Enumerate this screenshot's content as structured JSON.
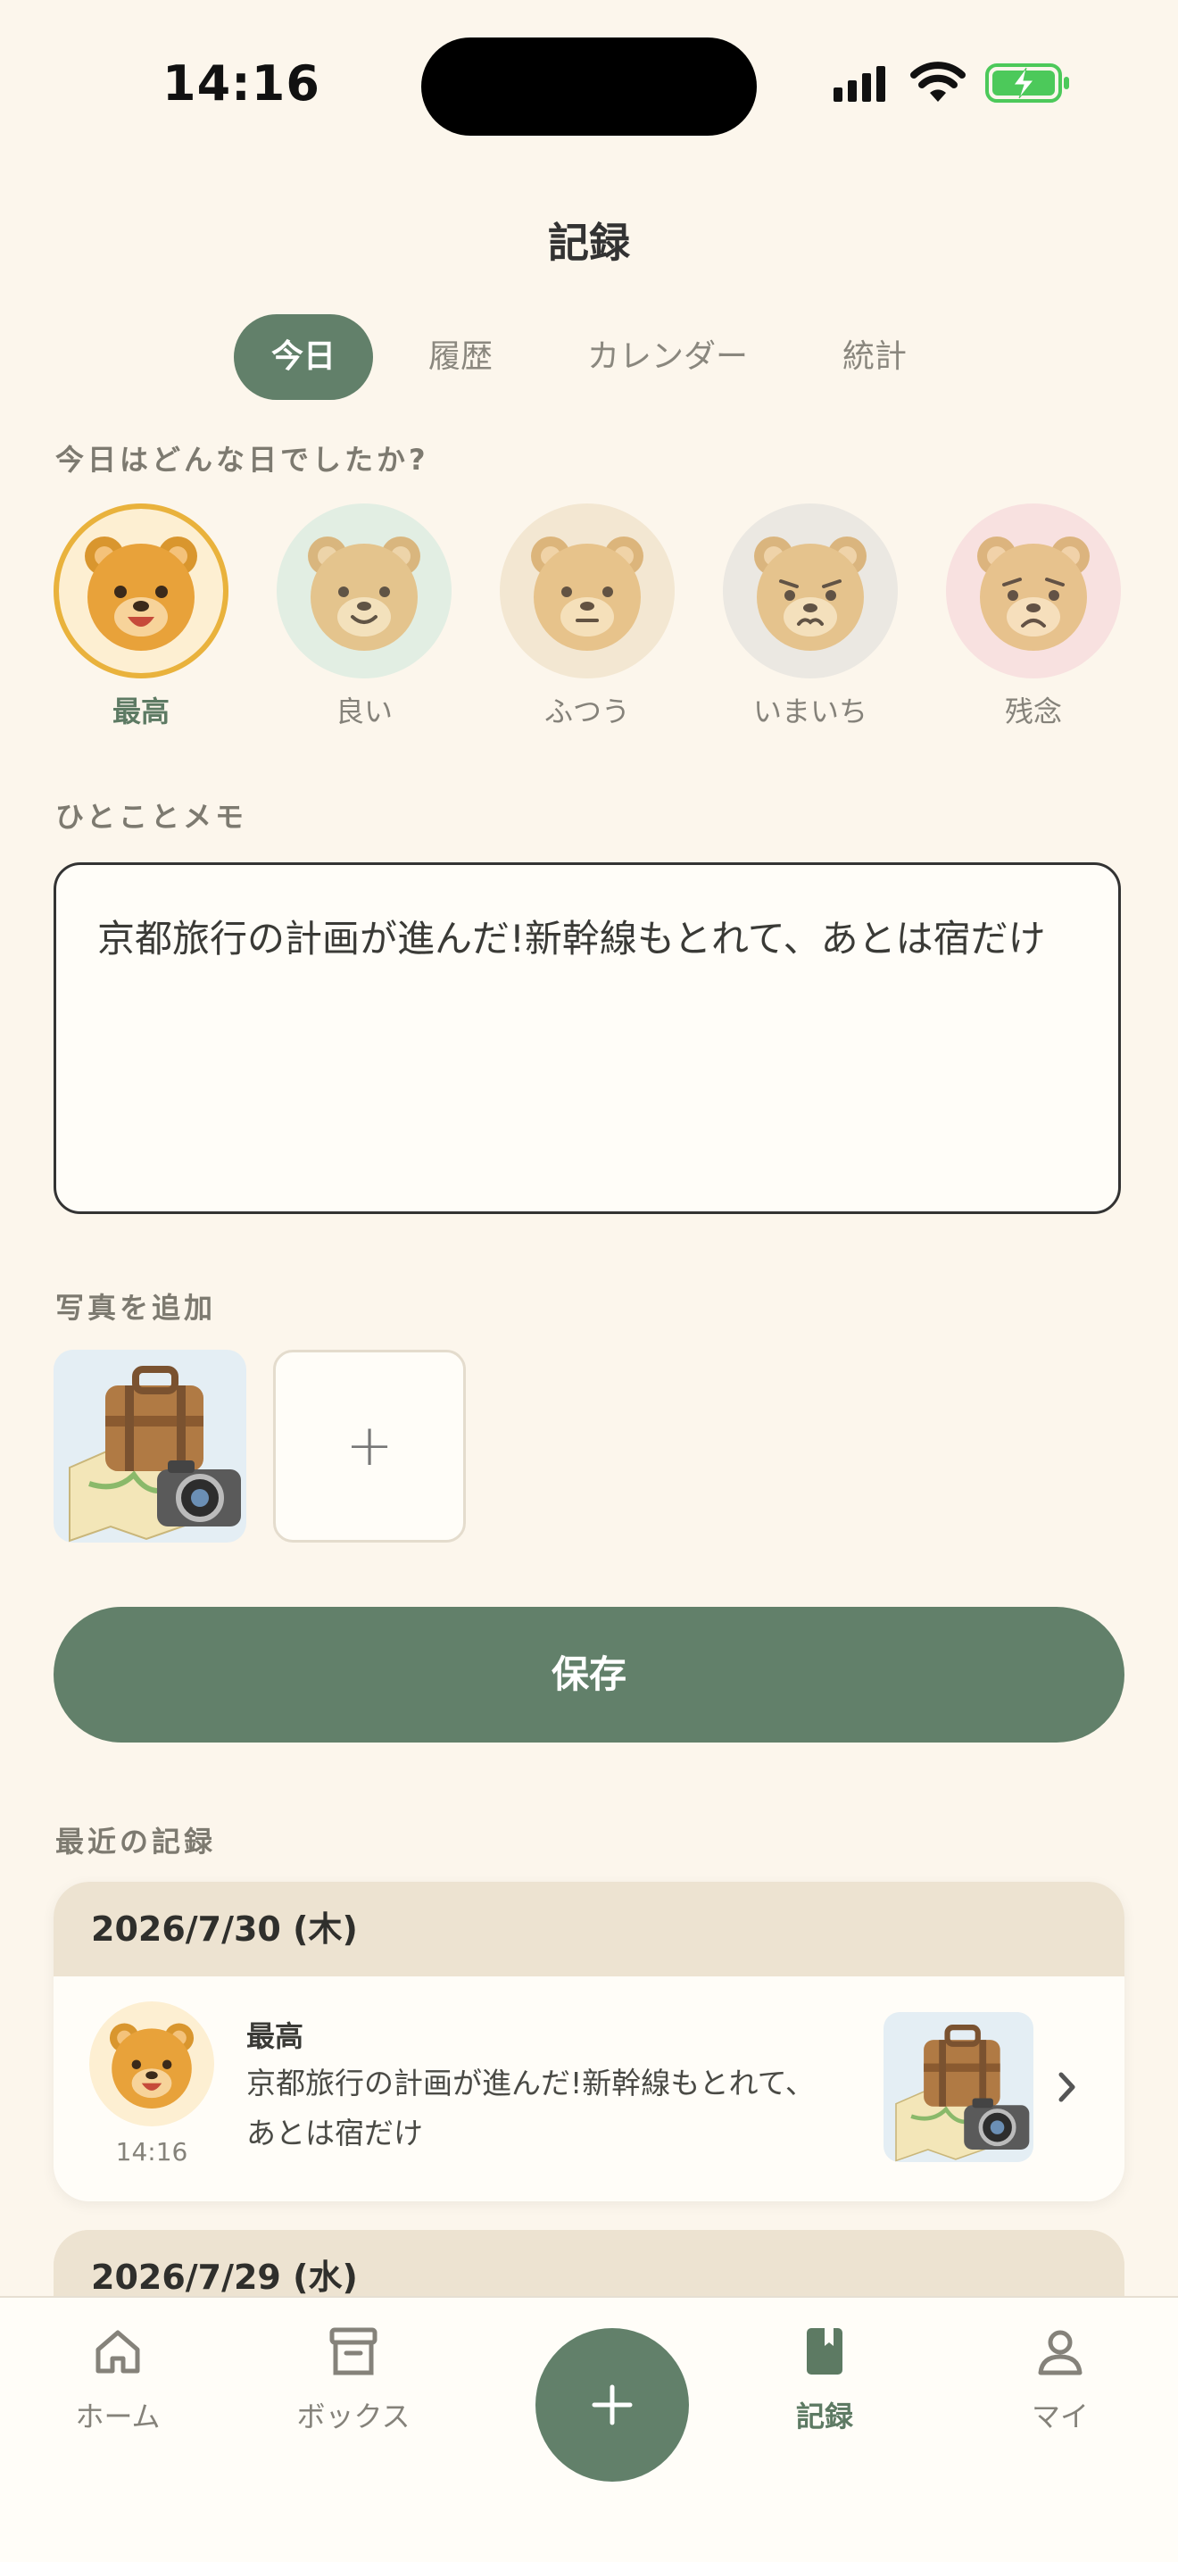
{
  "status_bar": {
    "time": "14:16"
  },
  "header": {
    "title": "記録"
  },
  "tabs": [
    {
      "label": "今日",
      "active": true
    },
    {
      "label": "履歴",
      "active": false
    },
    {
      "label": "カレンダー",
      "active": false
    },
    {
      "label": "統計",
      "active": false
    }
  ],
  "mood_section": {
    "label": "今日はどんな日でしたか?",
    "options": [
      {
        "label": "最高",
        "icon": "bear-grinning-icon",
        "selected": true
      },
      {
        "label": "良い",
        "icon": "bear-smiling-icon",
        "selected": false
      },
      {
        "label": "ふつう",
        "icon": "bear-neutral-icon",
        "selected": false
      },
      {
        "label": "いまいち",
        "icon": "bear-worried-icon",
        "selected": false
      },
      {
        "label": "残念",
        "icon": "bear-sad-icon",
        "selected": false
      }
    ]
  },
  "memo": {
    "label": "ひとことメモ",
    "value": "京都旅行の計画が進んだ!新幹線もとれて、あとは宿だけ"
  },
  "photos": {
    "label": "写真を追加",
    "items": [
      {
        "icon": "travel-photo-icon"
      }
    ],
    "add_symbol": "+"
  },
  "save_button": {
    "label": "保存"
  },
  "recent": {
    "label": "最近の記録",
    "entries": [
      {
        "date": "2026/7/30 (木)",
        "mood": "最高",
        "time": "14:16",
        "text": "京都旅行の計画が進んだ!新幹線もとれて、あとは宿だけ"
      },
      {
        "date": "2026/7/29 (水)"
      }
    ]
  },
  "nav": [
    {
      "label": "ホーム",
      "icon": "home-icon",
      "active": false
    },
    {
      "label": "ボックス",
      "icon": "box-icon",
      "active": false
    },
    {
      "label": "",
      "icon": "plus-icon",
      "active": false
    },
    {
      "label": "記録",
      "icon": "book-icon",
      "active": true
    },
    {
      "label": "マイ",
      "icon": "person-icon",
      "active": false
    }
  ],
  "colors": {
    "background": "#fcf6ec",
    "accent": "#62806a",
    "selected_ring": "#e9b23c"
  }
}
